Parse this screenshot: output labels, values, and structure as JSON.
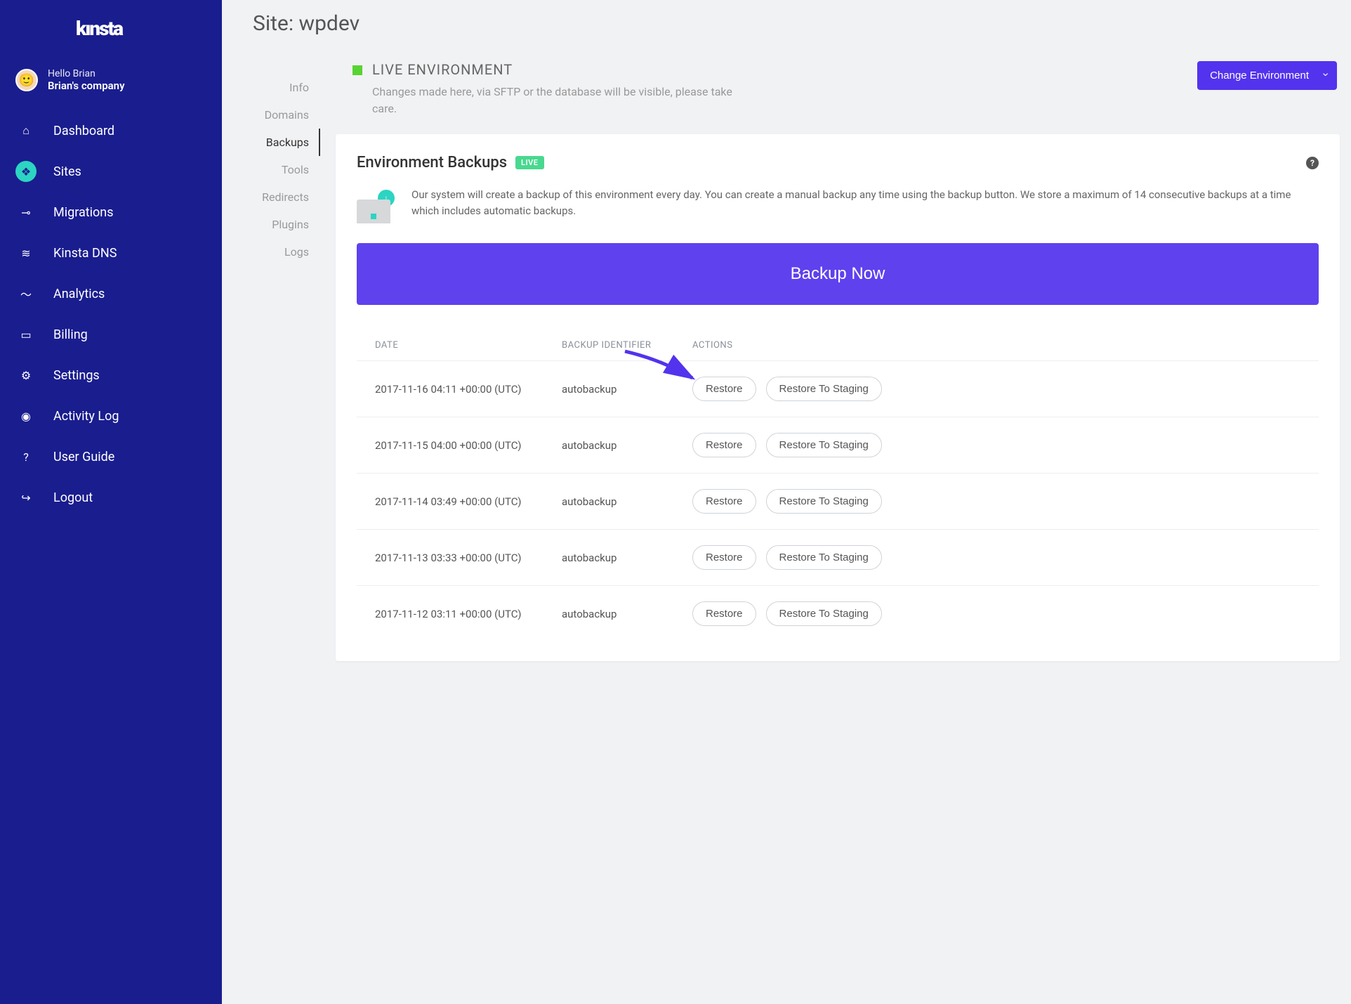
{
  "brand": "kınsta",
  "user": {
    "hello": "Hello Brian",
    "company": "Brian's company"
  },
  "nav": {
    "dashboard": "Dashboard",
    "sites": "Sites",
    "migrations": "Migrations",
    "kinsta_dns": "Kinsta DNS",
    "analytics": "Analytics",
    "billing": "Billing",
    "settings": "Settings",
    "activity_log": "Activity Log",
    "user_guide": "User Guide",
    "logout": "Logout"
  },
  "page": {
    "title": "Site: wpdev"
  },
  "subnav": {
    "info": "Info",
    "domains": "Domains",
    "backups": "Backups",
    "tools": "Tools",
    "redirects": "Redirects",
    "plugins": "Plugins",
    "logs": "Logs"
  },
  "env": {
    "title": "LIVE ENVIRONMENT",
    "desc": "Changes made here, via SFTP or the database will be visible, please take care.",
    "change_btn": "Change Environment"
  },
  "card": {
    "title": "Environment Backups",
    "badge": "LIVE",
    "help": "?",
    "info": "Our system will create a backup of this environment every day. You can create a manual backup any time using the backup button. We store a maximum of 14 consecutive backups at a time which includes automatic backups.",
    "backup_now": "Backup Now"
  },
  "table": {
    "head": {
      "date": "DATE",
      "id": "BACKUP IDENTIFIER",
      "actions": "ACTIONS"
    },
    "restore": "Restore",
    "restore_staging": "Restore To Staging",
    "rows": [
      {
        "date": "2017-11-16 04:11 +00:00 (UTC)",
        "id": "autobackup"
      },
      {
        "date": "2017-11-15 04:00 +00:00 (UTC)",
        "id": "autobackup"
      },
      {
        "date": "2017-11-14 03:49 +00:00 (UTC)",
        "id": "autobackup"
      },
      {
        "date": "2017-11-13 03:33 +00:00 (UTC)",
        "id": "autobackup"
      },
      {
        "date": "2017-11-12 03:11 +00:00 (UTC)",
        "id": "autobackup"
      }
    ]
  }
}
